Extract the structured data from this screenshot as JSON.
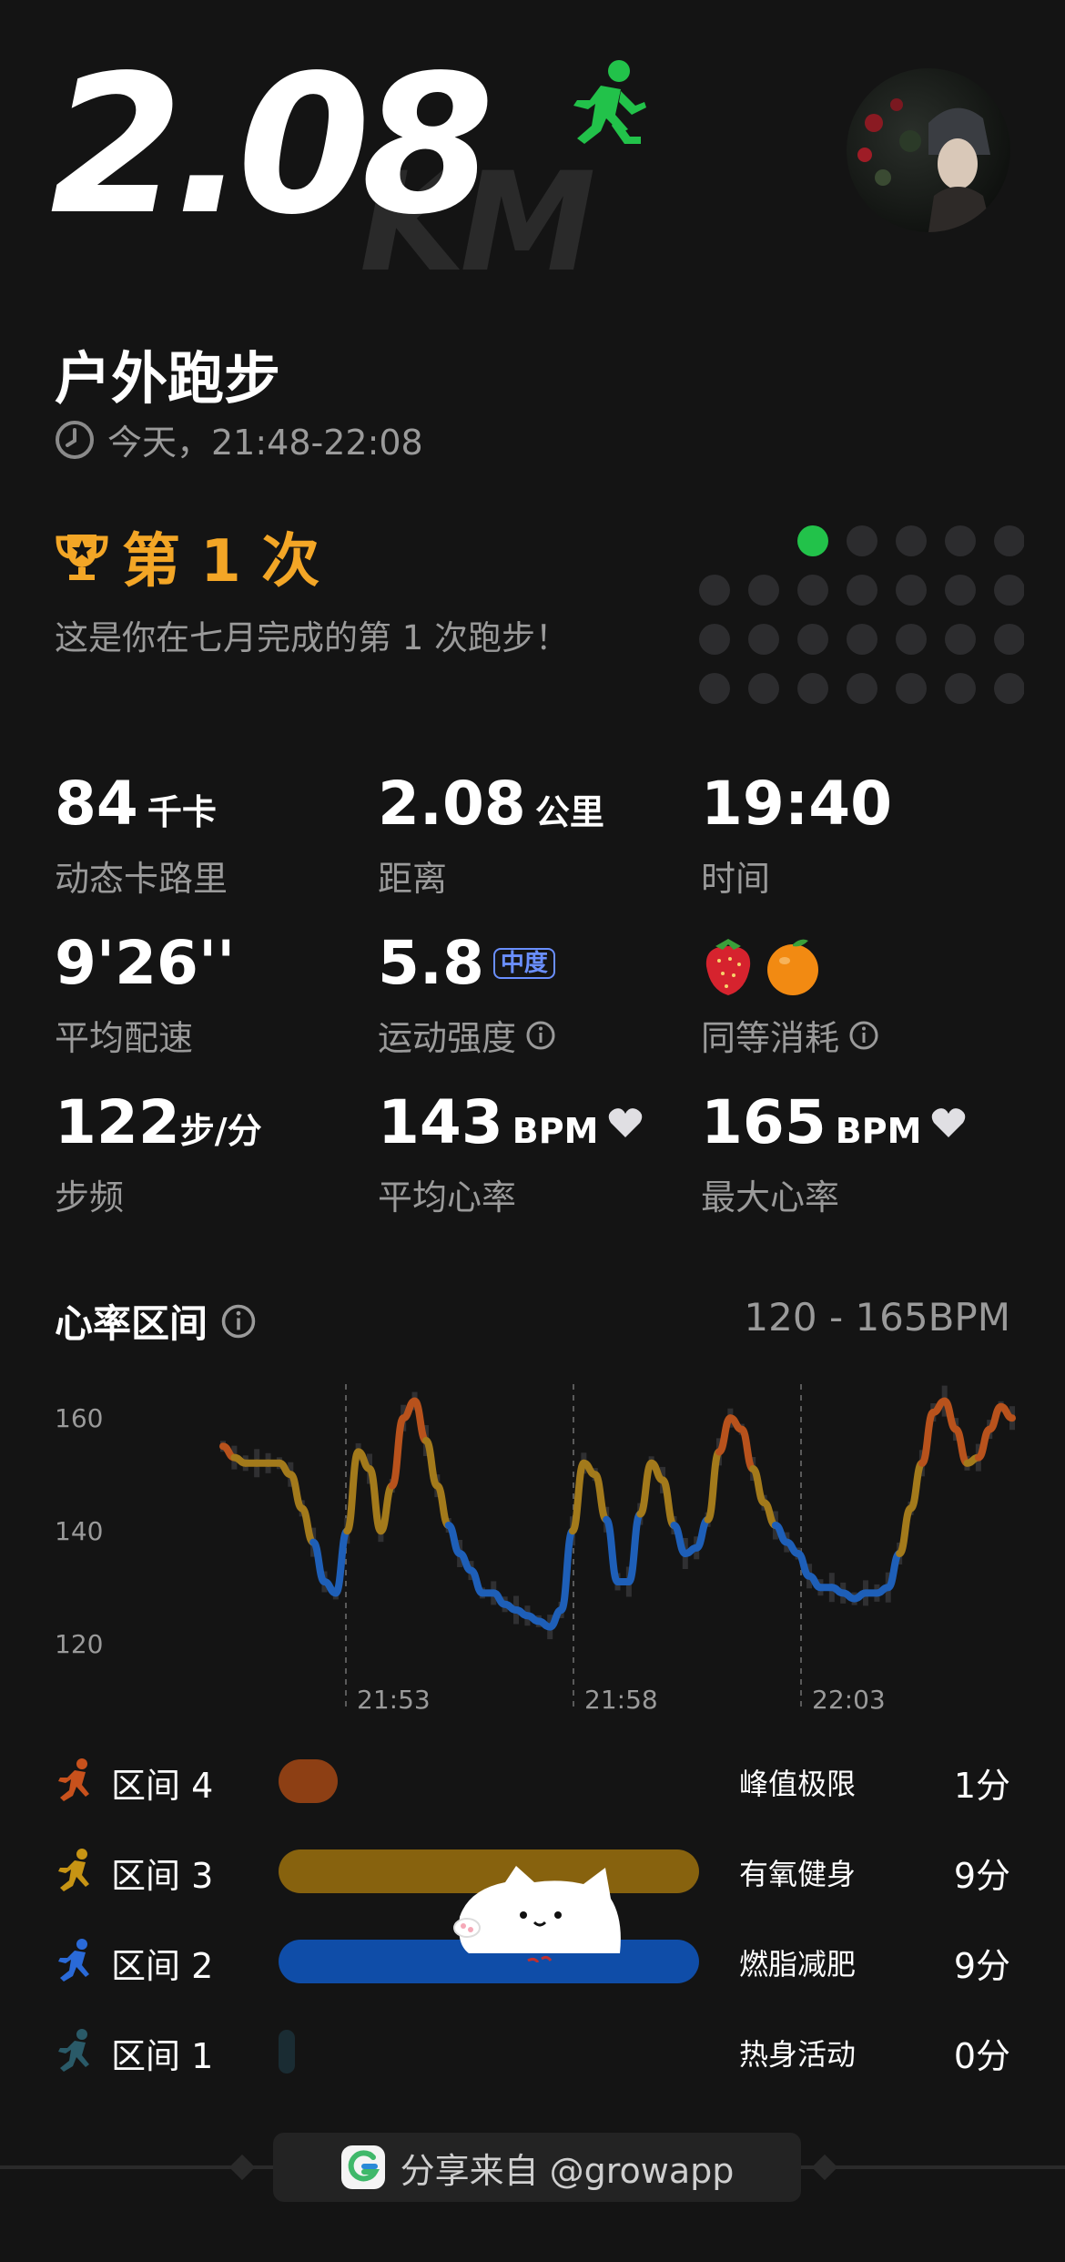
{
  "header": {
    "distance": "2.08",
    "unit_watermark": "KM",
    "activity_title": "户外跑步",
    "time_range": "今天，21:48-22:08"
  },
  "achievement": {
    "title": "第 1 次",
    "subtitle": "这是你在七月完成的第 1 次跑步！",
    "active_dots": 1
  },
  "stats": {
    "calories": {
      "value": "84",
      "unit": "千卡",
      "label": "动态卡路里"
    },
    "distance": {
      "value": "2.08",
      "unit": "公里",
      "label": "距离"
    },
    "duration": {
      "value": "19:40",
      "label": "时间"
    },
    "pace": {
      "value": "9'26''",
      "label": "平均配速"
    },
    "intensity": {
      "value": "5.8",
      "badge": "中度",
      "label": "运动强度"
    },
    "equivalent": {
      "label": "同等消耗",
      "items": [
        "strawberry-icon",
        "orange-icon"
      ]
    },
    "cadence": {
      "value": "122",
      "unit": "步/分",
      "label": "步频"
    },
    "avg_hr": {
      "value": "143",
      "unit": "BPM",
      "label": "平均心率"
    },
    "max_hr": {
      "value": "165",
      "unit": "BPM",
      "label": "最大心率"
    }
  },
  "heart_rate": {
    "title": "心率区间",
    "range": "120 - 165BPM",
    "chart_data": {
      "type": "line",
      "x_tick_labels": [
        "21:53",
        "21:58",
        "22:03"
      ],
      "y_tick_labels": [
        "160",
        "140",
        "120"
      ],
      "ylim": [
        116,
        166
      ],
      "grid": "vertical dashed at time ticks",
      "x": [
        0,
        1,
        2,
        3,
        4,
        5,
        6,
        7,
        8,
        9,
        10,
        11,
        12,
        13,
        14,
        15,
        16,
        17,
        18,
        19,
        20,
        21,
        22,
        23,
        24,
        25,
        26,
        27,
        28,
        29,
        30,
        31,
        32,
        33,
        34,
        35,
        36,
        37,
        38,
        39,
        40,
        41,
        42,
        43,
        44,
        45,
        46,
        47,
        48,
        49,
        50,
        51,
        52,
        53,
        54,
        55,
        56,
        57,
        58,
        59,
        60,
        61,
        62,
        63,
        64,
        65,
        66,
        67,
        68,
        69,
        70
      ],
      "values": [
        155,
        153,
        152,
        152,
        152,
        152,
        150,
        144,
        138,
        131,
        129,
        140,
        154,
        151,
        140,
        148,
        160,
        163,
        156,
        148,
        141,
        136,
        133,
        129,
        129,
        127,
        126,
        125,
        124,
        123,
        126,
        140,
        152,
        150,
        142,
        131,
        131,
        143,
        152,
        149,
        141,
        136,
        137,
        142,
        154,
        160,
        158,
        151,
        145,
        141,
        138,
        136,
        132,
        130,
        130,
        129,
        128,
        129,
        129,
        130,
        136,
        144,
        152,
        161,
        163,
        158,
        152,
        153,
        158,
        162,
        160
      ],
      "zone_colors": {
        "zone4": "#b8521c",
        "zone3": "#a37a1b",
        "zone2": "#1e5fb8"
      }
    }
  },
  "zones": [
    {
      "label": "区间 4",
      "name": "峰值极限",
      "time": "1分",
      "color": "#8d3f14",
      "fraction": 0.14,
      "icon": "runner-fast-icon"
    },
    {
      "label": "区间 3",
      "name": "有氧健身",
      "time": "9分",
      "color": "#87620e",
      "fraction": 1.0,
      "icon": "runner-icon"
    },
    {
      "label": "区间 2",
      "name": "燃脂减肥",
      "time": "9分",
      "color": "#0f4da8",
      "fraction": 1.0,
      "icon": "runner-blue-icon"
    },
    {
      "label": "区间 1",
      "name": "热身活动",
      "time": "0分",
      "color": "#1a2c33",
      "fraction": 0.04,
      "icon": "walker-icon"
    }
  ],
  "footer": {
    "text": "分享来自 @growapp"
  },
  "colors": {
    "background": "#141414",
    "accent_green": "#22c24a",
    "achievement_gold": "#f3a626",
    "muted_text": "#9a9a9a"
  }
}
